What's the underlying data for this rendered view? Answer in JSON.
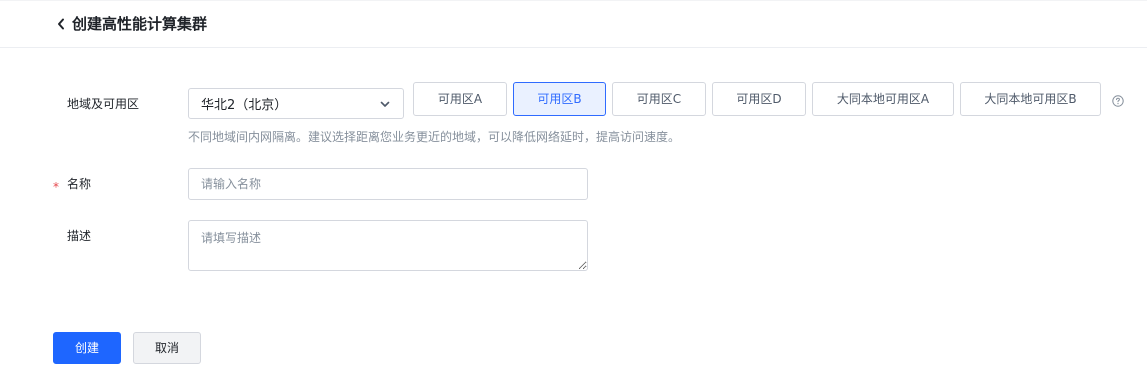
{
  "header": {
    "back_icon": "chevron-left-icon",
    "title": "创建高性能计算集群"
  },
  "form": {
    "region": {
      "label": "地域及可用区",
      "selected": "华北2（北京）",
      "dropdown_icon": "chevron-down-icon",
      "zones": [
        {
          "label": "可用区A",
          "active": false
        },
        {
          "label": "可用区B",
          "active": true
        },
        {
          "label": "可用区C",
          "active": false
        },
        {
          "label": "可用区D",
          "active": false
        },
        {
          "label": "大同本地可用区A",
          "active": false
        },
        {
          "label": "大同本地可用区B",
          "active": false
        }
      ],
      "help_icon": "question-circle-icon",
      "hint": "不同地域间内网隔离。建议选择距离您业务更近的地域，可以降低网络延时，提高访问速度。"
    },
    "name": {
      "required_mark": "*",
      "label": "名称",
      "placeholder": "请输入名称",
      "value": ""
    },
    "description": {
      "label": "描述",
      "placeholder": "请填写描述",
      "value": ""
    }
  },
  "actions": {
    "create_label": "创建",
    "cancel_label": "取消"
  },
  "colors": {
    "primary": "#1e66ff",
    "active_zone_bg": "#eaf1ff",
    "active_zone_border": "#2f6bff",
    "required": "#e5484d",
    "hint_text": "#86909c"
  }
}
